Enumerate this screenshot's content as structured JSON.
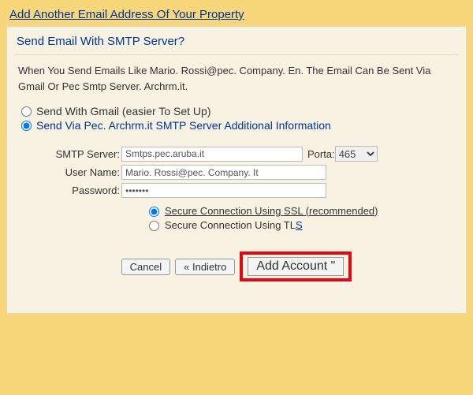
{
  "window_title": "Add Another Email Address Of Your Property",
  "panel": {
    "title": "Send Email With SMTP Server?",
    "description": "When You Send Emails Like Mario. Rossi@pec. Company. En. The Email Can Be Sent Via Gmail Or Pec Smtp Server. Archrm.it.",
    "radio_gmail": "Send With Gmail (easier To Set Up)",
    "radio_smtp": "Send Via Pec. Archrm.it SMTP Server Additional Information"
  },
  "form": {
    "smtp_label": "SMTP Server:",
    "smtp_value": "Smtps.pec.aruba.it",
    "porta_label": "Porta:",
    "porta_value": "465",
    "user_label": "User Name:",
    "user_value": "Mario. Rossi@pec. Company. It",
    "pass_label": "Password:",
    "pass_value": "•••••••",
    "ssl_label": "Secure Connection Using SSL (recommended)",
    "tls_label_a": "Secure Connection Using TL",
    "tls_label_b": "S"
  },
  "buttons": {
    "cancel": "Cancel",
    "back": "« Indietro",
    "add": "Add Account \""
  }
}
